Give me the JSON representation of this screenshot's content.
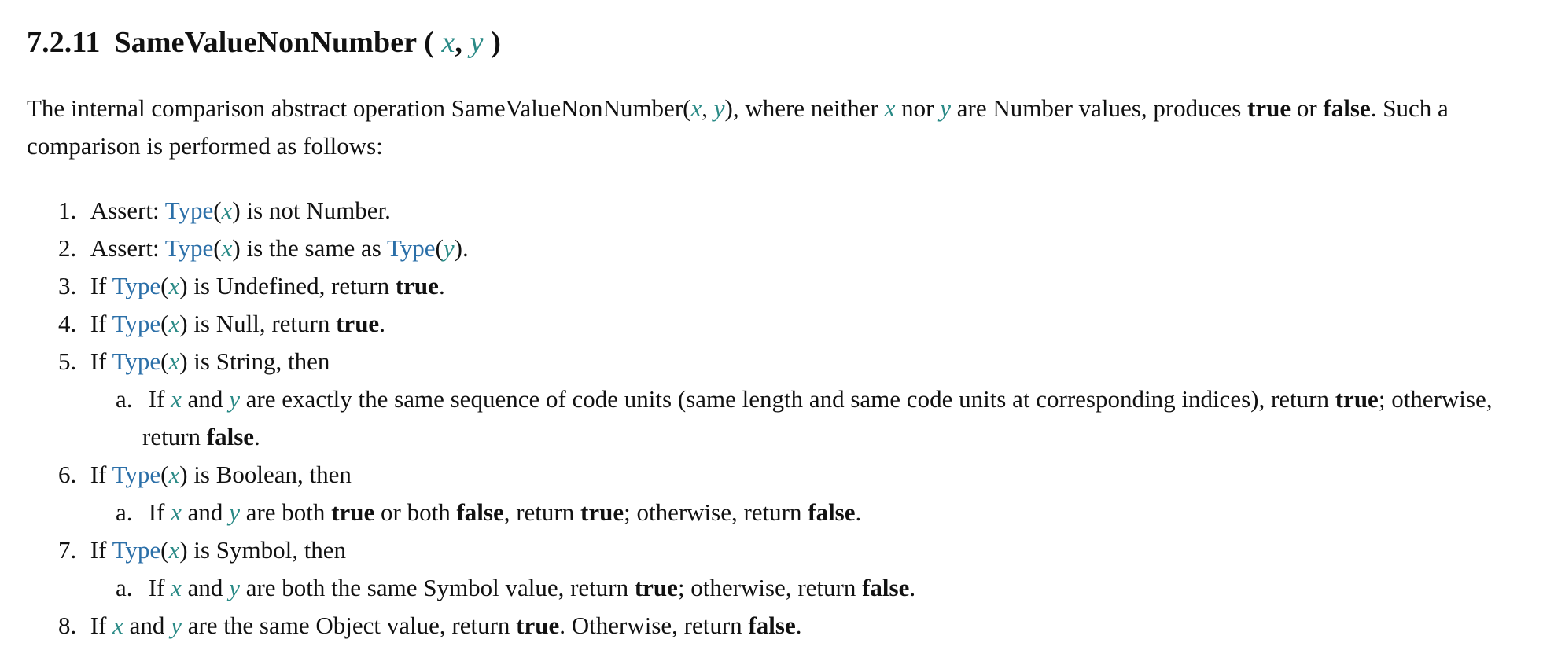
{
  "heading": {
    "number": "7.2.11",
    "title": "SameValueNonNumber",
    "open_paren": "(",
    "param_x": "x",
    "comma": ",",
    "param_y": "y",
    "close_paren": ")"
  },
  "intro": {
    "t1": "The internal comparison abstract operation SameValueNonNumber(",
    "x1": "x",
    "t2": ", ",
    "y1": "y",
    "t3": "), where neither ",
    "x2": "x",
    "t4": " nor ",
    "y2": "y",
    "t5": " are Number values, produces ",
    "true_label": "true",
    "t6": " or ",
    "false_label": "false",
    "t7": ". Such a comparison is performed as follows:"
  },
  "steps": [
    {
      "num": "1.",
      "a": "Assert: ",
      "type_link": "Type",
      "lp": "(",
      "var": "x",
      "rp": ")",
      "b": " is not Number."
    },
    {
      "num": "2.",
      "a": "Assert: ",
      "type_link": "Type",
      "lp": "(",
      "var": "x",
      "rp": ")",
      "b": " is the same as ",
      "type_link2": "Type",
      "lp2": "(",
      "var2": "y",
      "rp2": ")",
      "c": "."
    },
    {
      "num": "3.",
      "a": "If ",
      "type_link": "Type",
      "lp": "(",
      "var": "x",
      "rp": ")",
      "b": " is Undefined, return ",
      "bold": "true",
      "c": "."
    },
    {
      "num": "4.",
      "a": "If ",
      "type_link": "Type",
      "lp": "(",
      "var": "x",
      "rp": ")",
      "b": " is Null, return ",
      "bold": "true",
      "c": "."
    },
    {
      "num": "5.",
      "a": "If ",
      "type_link": "Type",
      "lp": "(",
      "var": "x",
      "rp": ")",
      "b": " is String, then",
      "sub": {
        "num": "a.",
        "a": "If ",
        "x": "x",
        "and": " and ",
        "y": "y",
        "b": " are exactly the same sequence of code units (same length and same code units at corresponding indices), return ",
        "true_label": "true",
        "c": "; otherwise, return ",
        "false_label": "false",
        "d": "."
      }
    },
    {
      "num": "6.",
      "a": "If ",
      "type_link": "Type",
      "lp": "(",
      "var": "x",
      "rp": ")",
      "b": " is Boolean, then",
      "sub": {
        "num": "a.",
        "a": "If ",
        "x": "x",
        "and": " and ",
        "y": "y",
        "b": " are both ",
        "true_label": "true",
        "c": " or both ",
        "false_label": "false",
        "d": ", return ",
        "true_label2": "true",
        "e": "; otherwise, return ",
        "false_label2": "false",
        "f": "."
      }
    },
    {
      "num": "7.",
      "a": "If ",
      "type_link": "Type",
      "lp": "(",
      "var": "x",
      "rp": ")",
      "b": " is Symbol, then",
      "sub": {
        "num": "a.",
        "a": "If ",
        "x": "x",
        "and": " and ",
        "y": "y",
        "b": " are both the same Symbol value, return ",
        "true_label": "true",
        "c": "; otherwise, return ",
        "false_label": "false",
        "d": "."
      }
    },
    {
      "num": "8.",
      "a": "If ",
      "x": "x",
      "and": " and ",
      "y": "y",
      "b": " are the same Object value, return ",
      "true_label": "true",
      "c": ". Otherwise, return ",
      "false_label": "false",
      "d": "."
    }
  ],
  "colors": {
    "variable": "#2a8a86",
    "link": "#2b6fa8",
    "text": "#111111"
  }
}
